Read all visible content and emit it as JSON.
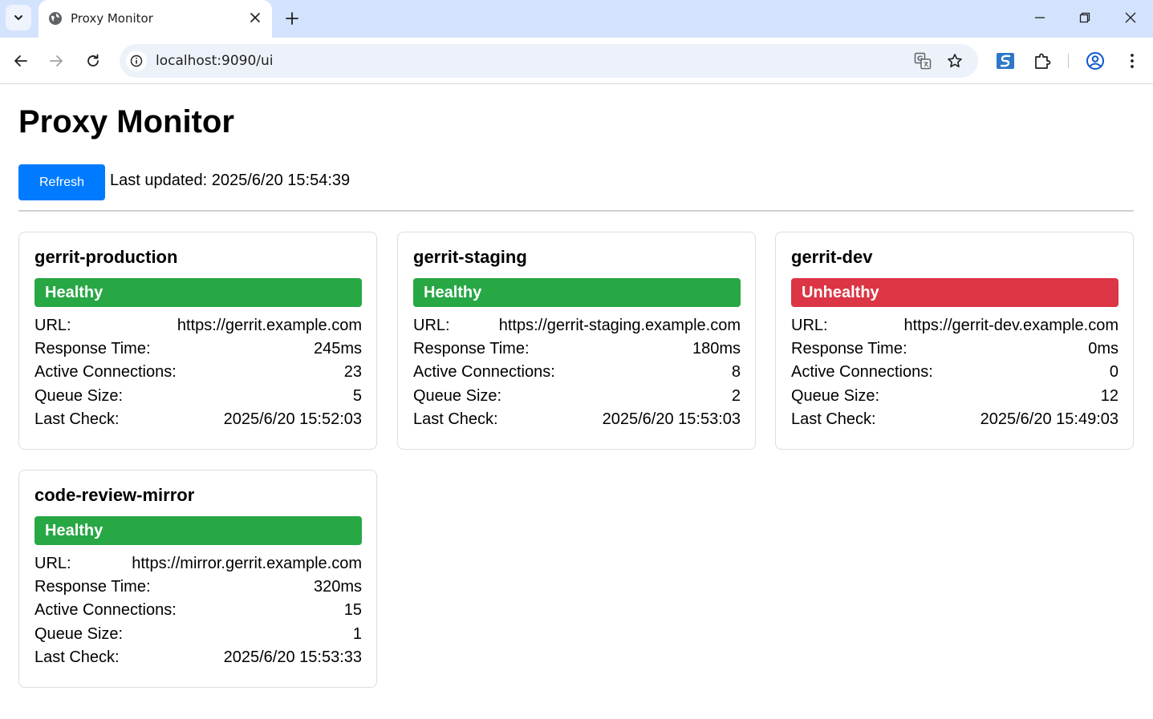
{
  "browser": {
    "tab_title": "Proxy Monitor",
    "url": "localhost:9090/ui"
  },
  "page": {
    "title": "Proxy Monitor",
    "refresh_label": "Refresh",
    "last_updated": "Last updated: 2025/6/20 15:54:39"
  },
  "labels": {
    "url": "URL:",
    "response_time": "Response Time:",
    "active_connections": "Active Connections:",
    "queue_size": "Queue Size:",
    "last_check": "Last Check:"
  },
  "colors": {
    "healthy": "#28a745",
    "unhealthy": "#dc3545",
    "primary": "#007bff"
  },
  "proxies": [
    {
      "name": "gerrit-production",
      "status": "Healthy",
      "url": "https://gerrit.example.com",
      "response_time": "245ms",
      "active_connections": "23",
      "queue_size": "5",
      "last_check": "2025/6/20 15:52:03"
    },
    {
      "name": "gerrit-staging",
      "status": "Healthy",
      "url": "https://gerrit-staging.example.com",
      "response_time": "180ms",
      "active_connections": "8",
      "queue_size": "2",
      "last_check": "2025/6/20 15:53:03"
    },
    {
      "name": "gerrit-dev",
      "status": "Unhealthy",
      "url": "https://gerrit-dev.example.com",
      "response_time": "0ms",
      "active_connections": "0",
      "queue_size": "12",
      "last_check": "2025/6/20 15:49:03"
    },
    {
      "name": "code-review-mirror",
      "status": "Healthy",
      "url": "https://mirror.gerrit.example.com",
      "response_time": "320ms",
      "active_connections": "15",
      "queue_size": "1",
      "last_check": "2025/6/20 15:53:33"
    }
  ]
}
